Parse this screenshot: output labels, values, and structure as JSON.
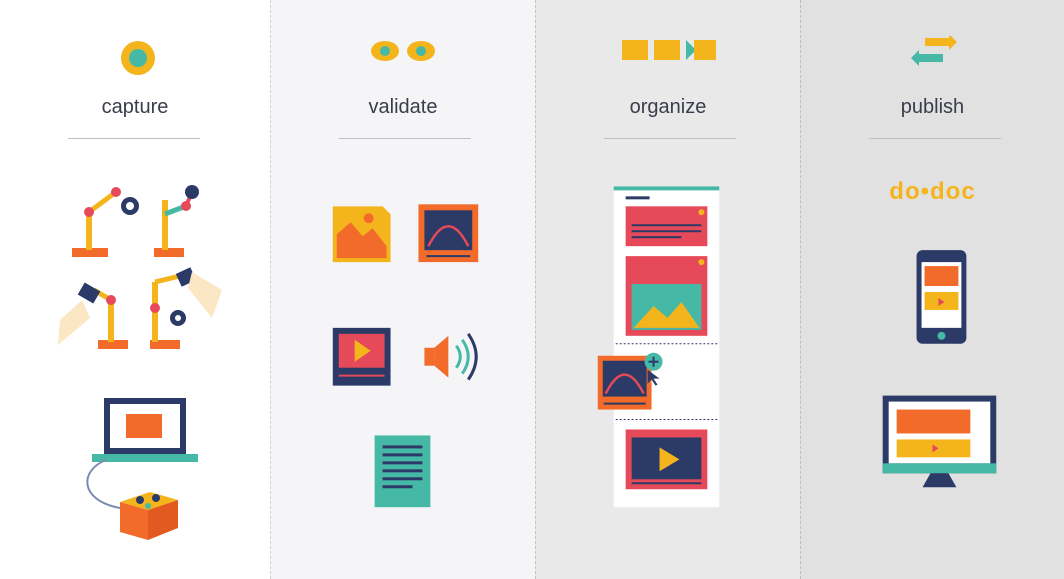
{
  "stages": [
    {
      "id": "capture",
      "label": "capture"
    },
    {
      "id": "validate",
      "label": "validate"
    },
    {
      "id": "organize",
      "label": "organize"
    },
    {
      "id": "publish",
      "label": "publish"
    }
  ],
  "logo": {
    "text": "do•doc"
  },
  "colors": {
    "yellow": "#f4b41b",
    "orange": "#f26b2a",
    "teal": "#46b9a6",
    "red": "#e64a5a",
    "navy": "#2b3a67",
    "cream": "#fbe7c4",
    "pink": "#f2a0b0"
  }
}
